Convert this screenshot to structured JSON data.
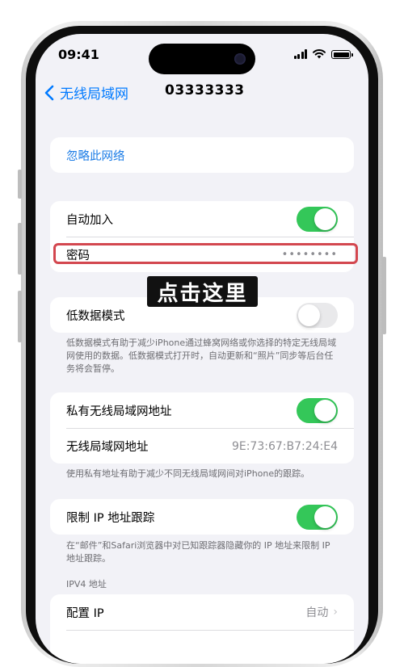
{
  "status": {
    "time": "09:41"
  },
  "nav": {
    "back_label": "无线局域网",
    "title": "03333333"
  },
  "forget": {
    "label": "忽略此网络"
  },
  "autojoin": {
    "label": "自动加入",
    "on": true
  },
  "password": {
    "label": "密码",
    "mask": "••••••••"
  },
  "callout": {
    "text": "点击这里"
  },
  "lowdata": {
    "label": "低数据模式",
    "on": false,
    "note": "低数据模式有助于减少iPhone通过蜂窝网络或你选择的特定无线局域网使用的数据。低数据模式打开时，自动更新和“照片”同步等后台任务将会暂停。"
  },
  "private_addr": {
    "label": "私有无线局域网地址",
    "on": true,
    "addr_label": "无线局域网地址",
    "addr_value": "9E:73:67:B7:24:E4",
    "note": "使用私有地址有助于减少不同无线局域网间对iPhone的跟踪。"
  },
  "limit_ip": {
    "label": "限制 IP 地址跟踪",
    "on": true,
    "note": "在“邮件”和Safari浏览器中对已知跟踪器隐藏你的 IP 地址来限制 IP 地址跟踪。"
  },
  "ipv4": {
    "header": "IPV4 地址",
    "config_label": "配置 IP",
    "config_value": "自动"
  },
  "colors": {
    "accent": "#007aff",
    "toggle_on": "#34c759",
    "highlight": "#d3474f",
    "background": "#f2f2f7"
  }
}
